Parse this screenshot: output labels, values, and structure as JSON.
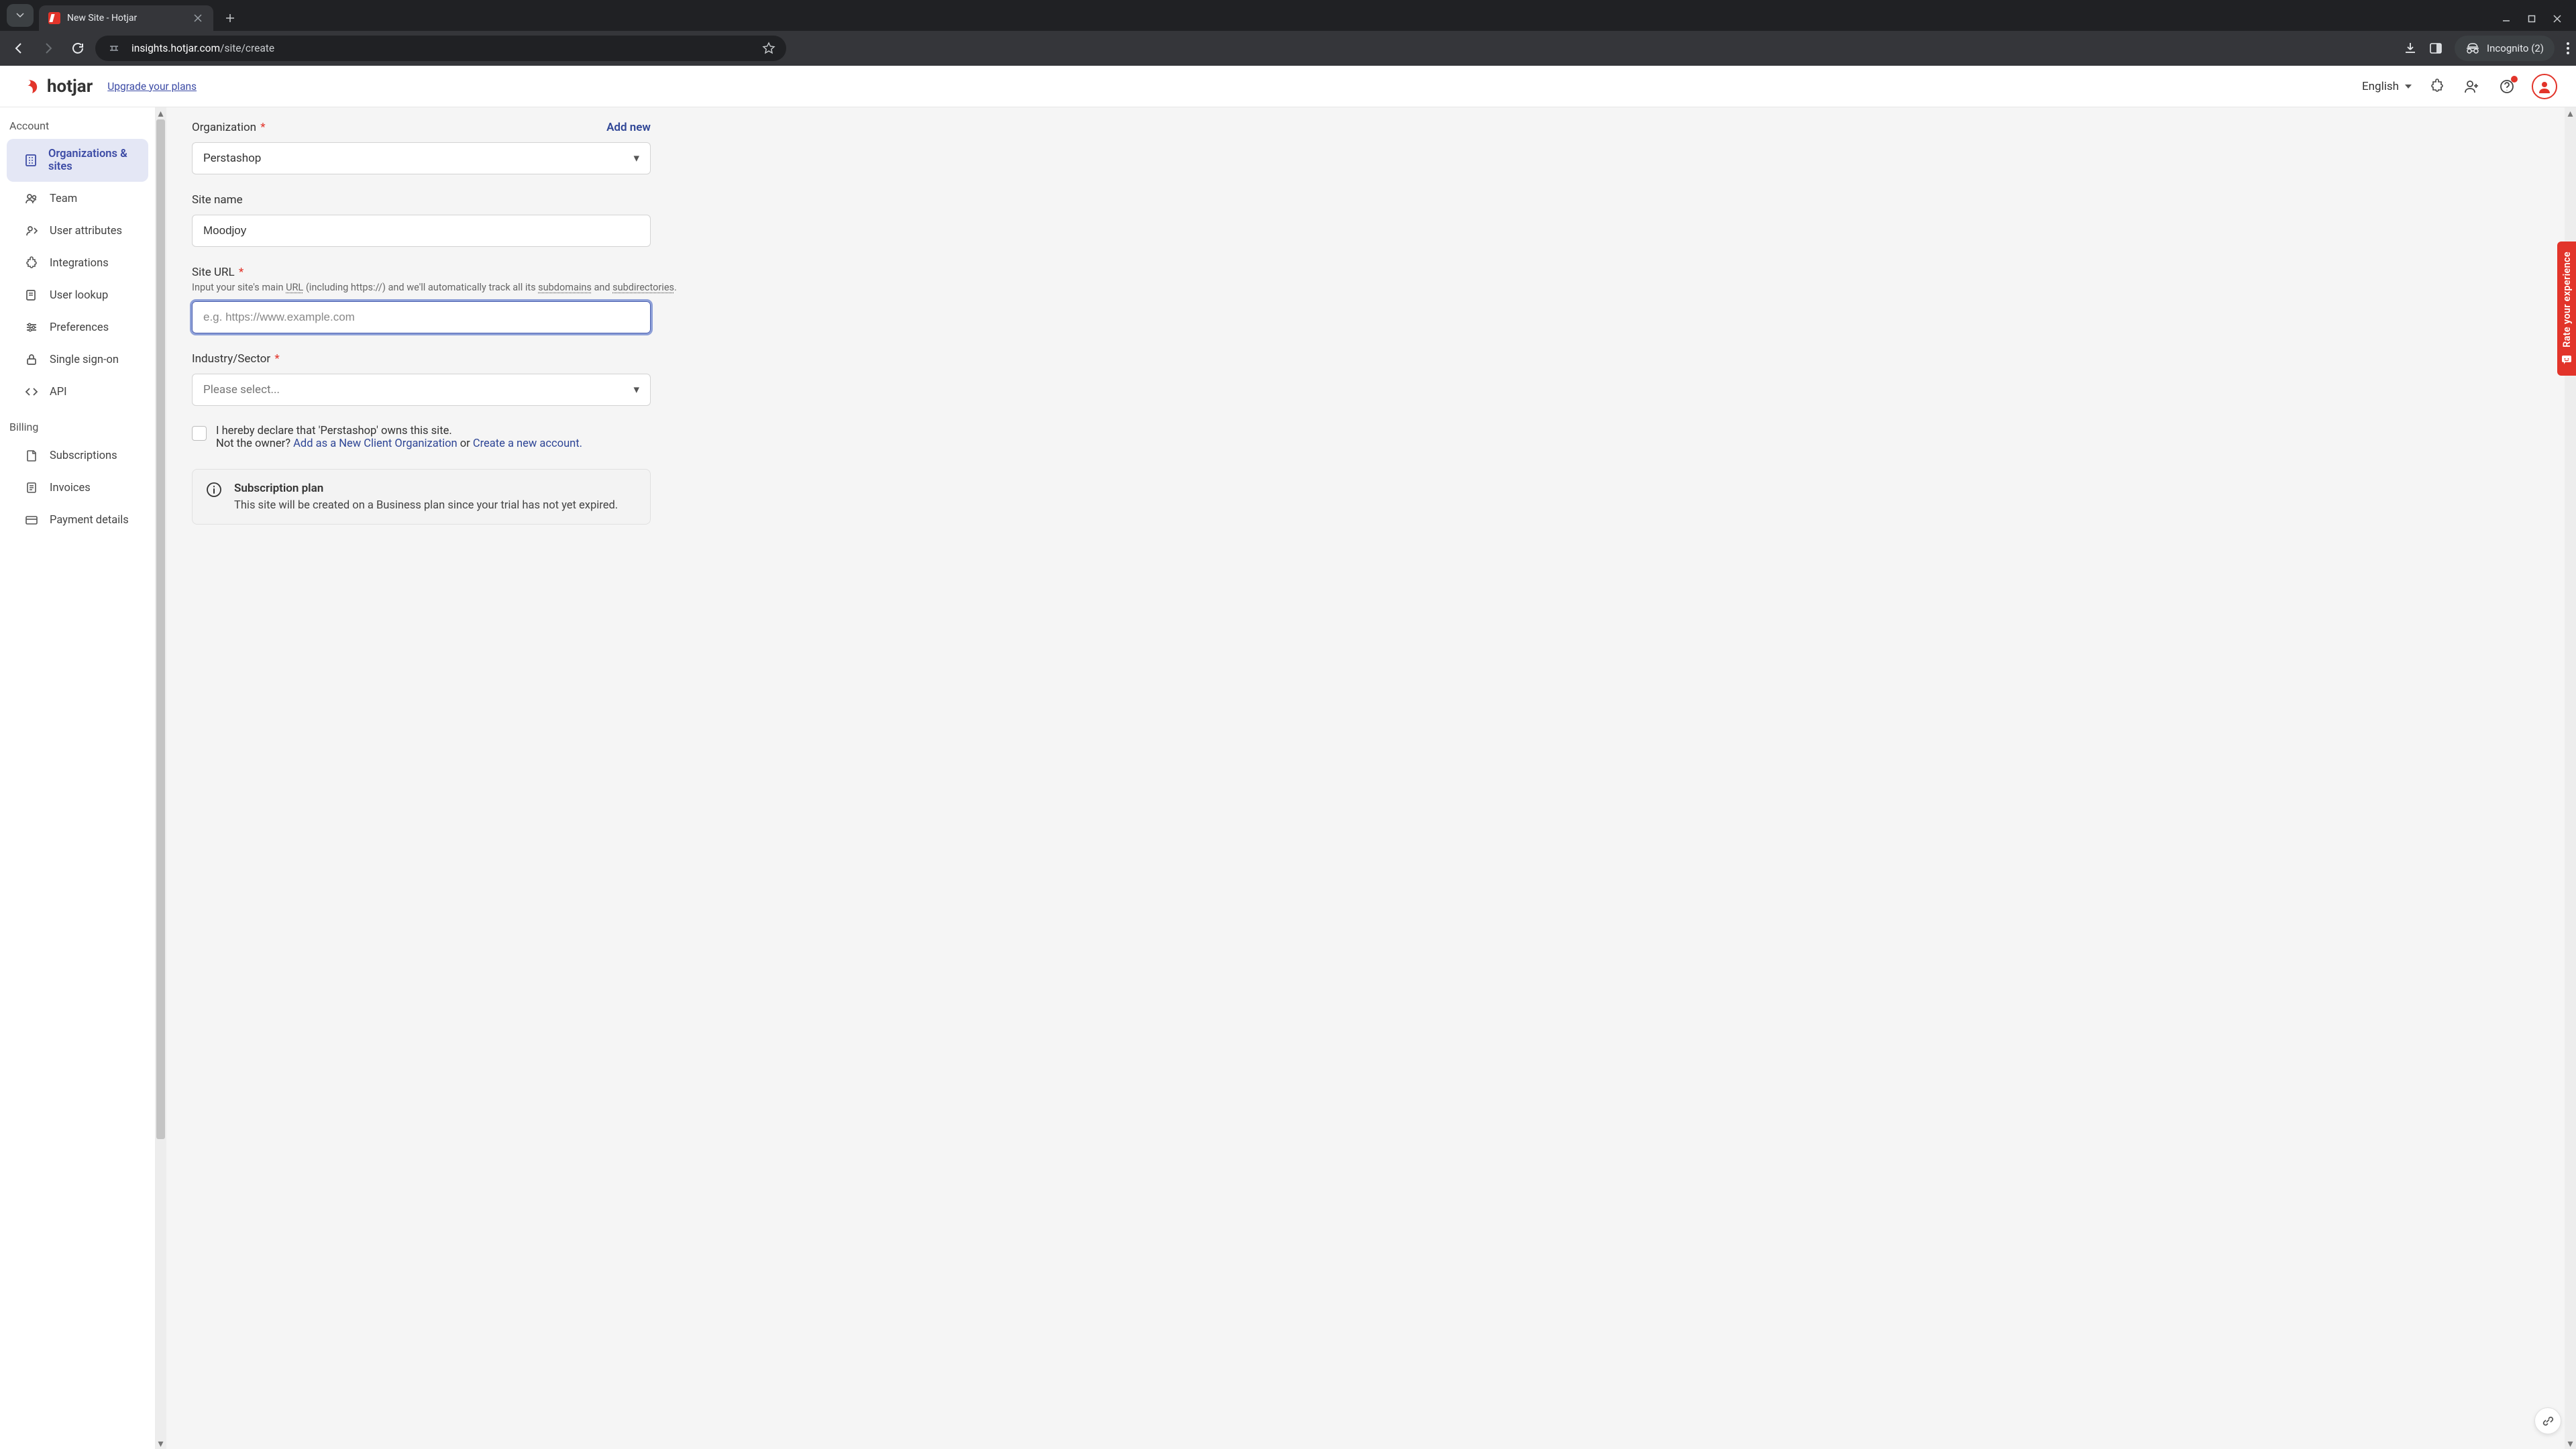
{
  "browser": {
    "tab_title": "New Site - Hotjar",
    "url_host": "insights.hotjar.com",
    "url_path": "/site/create",
    "incognito_label": "Incognito (2)"
  },
  "header": {
    "logo_text": "hotjar",
    "upgrade": "Upgrade your plans",
    "language": "English"
  },
  "sidebar": {
    "section_account": "Account",
    "section_billing": "Billing",
    "items_account": [
      {
        "label": "Organizations & sites"
      },
      {
        "label": "Team"
      },
      {
        "label": "User attributes"
      },
      {
        "label": "Integrations"
      },
      {
        "label": "User lookup"
      },
      {
        "label": "Preferences"
      },
      {
        "label": "Single sign-on"
      },
      {
        "label": "API"
      }
    ],
    "items_billing": [
      {
        "label": "Subscriptions"
      },
      {
        "label": "Invoices"
      },
      {
        "label": "Payment details"
      }
    ]
  },
  "form": {
    "organization": {
      "label": "Organization",
      "value": "Perstashop",
      "add_new": "Add new"
    },
    "site_name": {
      "label": "Site name",
      "value": "Moodjoy"
    },
    "site_url": {
      "label": "Site URL",
      "help_prefix": "Input your site's main ",
      "help_url_word": "URL",
      "help_mid": " (including https://) and we'll automatically track all its ",
      "help_subdomains": "subdomains",
      "help_and": " and ",
      "help_subdirs": "subdirectories",
      "help_suffix": ".",
      "placeholder": "e.g. https://www.example.com",
      "value": ""
    },
    "industry": {
      "label": "Industry/Sector",
      "value": "Please select..."
    },
    "declare": {
      "text": "I hereby declare that 'Perstashop' owns this site.",
      "not_owner": "Not the owner? ",
      "link1": "Add as a New Client Organization",
      "mid": " or ",
      "link2": "Create a new account."
    },
    "info": {
      "title": "Subscription plan",
      "body": "This site will be created on a Business plan since your trial has not yet expired."
    }
  },
  "feedback_label": "Rate your experience"
}
